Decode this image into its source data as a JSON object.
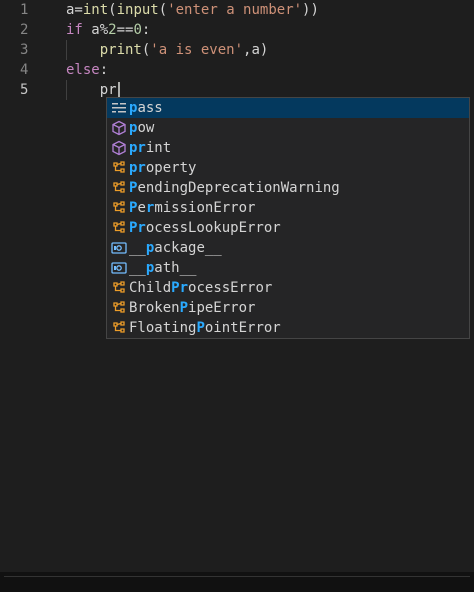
{
  "lines": [
    {
      "num": "1",
      "segments": [
        {
          "t": "a=",
          "c": "plain"
        },
        {
          "t": "int",
          "c": "fn"
        },
        {
          "t": "(",
          "c": "plain"
        },
        {
          "t": "input",
          "c": "fn"
        },
        {
          "t": "(",
          "c": "plain"
        },
        {
          "t": "'enter a number'",
          "c": "str"
        },
        {
          "t": "))",
          "c": "plain"
        }
      ]
    },
    {
      "num": "2",
      "segments": [
        {
          "t": "if ",
          "c": "kw"
        },
        {
          "t": "a%",
          "c": "plain"
        },
        {
          "t": "2",
          "c": "num"
        },
        {
          "t": "==",
          "c": "plain"
        },
        {
          "t": "0",
          "c": "num"
        },
        {
          "t": ":",
          "c": "plain"
        }
      ]
    },
    {
      "num": "3",
      "segments": [
        {
          "t": "    print",
          "c": "fn"
        },
        {
          "t": "(",
          "c": "plain"
        },
        {
          "t": "'a is even'",
          "c": "str"
        },
        {
          "t": ",a)",
          "c": "plain"
        }
      ]
    },
    {
      "num": "4",
      "segments": [
        {
          "t": "else",
          "c": "kw"
        },
        {
          "t": ":",
          "c": "plain"
        }
      ]
    },
    {
      "num": "5",
      "segments": [
        {
          "t": "    pr",
          "c": "plain"
        }
      ]
    }
  ],
  "suggestions": [
    {
      "match": "p",
      "rest": "ass",
      "mid": "",
      "tail": "",
      "icon": "keyword-icon",
      "selected": true
    },
    {
      "match": "p",
      "rest": "ow",
      "mid": "",
      "tail": "",
      "icon": "function-cube-icon",
      "selected": false
    },
    {
      "match": "pr",
      "rest": "int",
      "mid": "",
      "tail": "",
      "icon": "function-cube-icon",
      "selected": false
    },
    {
      "match": "pr",
      "rest": "operty",
      "mid": "",
      "tail": "",
      "icon": "class-icon",
      "selected": false
    },
    {
      "match": "P",
      "rest": "endingDeprecationWarning",
      "mid": "",
      "tail": "",
      "icon": "class-icon",
      "selected": false
    },
    {
      "match": "P",
      "rest": "e",
      "mid": "r",
      "tail": "missionError",
      "icon": "class-icon",
      "selected": false
    },
    {
      "match": "Pr",
      "rest": "ocessLookupError",
      "mid": "",
      "tail": "",
      "icon": "class-icon",
      "selected": false
    },
    {
      "match": "",
      "rest": "__",
      "mid": "p",
      "tail": "ackage__",
      "icon": "module-icon",
      "selected": false
    },
    {
      "match": "",
      "rest": "__",
      "mid": "p",
      "tail": "ath__",
      "icon": "module-icon",
      "selected": false
    },
    {
      "match": "",
      "rest": "ChildP",
      "mid": "r",
      "tail": "ocessError",
      "icon": "class-icon",
      "selected": false
    },
    {
      "match": "",
      "rest": "BrokenP",
      "mid": "",
      "tail": "ipeError",
      "icon": "class-icon",
      "selected": false
    },
    {
      "match": "",
      "rest": "FloatingP",
      "mid": "",
      "tail": "ointError",
      "icon": "class-icon",
      "selected": false
    }
  ],
  "colors": {
    "keyword": "#c586c0",
    "function": "#dcdcaa",
    "string": "#ce9178",
    "number": "#b5cea8",
    "match_highlight": "#2aaaff",
    "selection": "#04395e",
    "cube_icon": "#b180d7",
    "class_icon": "#ee9d28",
    "module_icon": "#75beff"
  }
}
